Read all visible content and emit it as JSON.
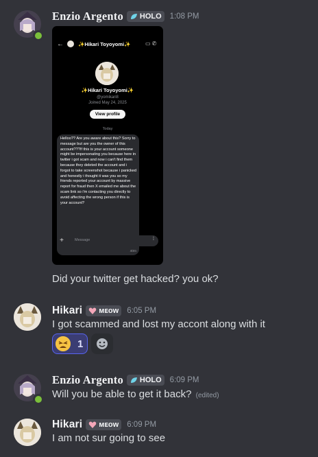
{
  "messages": [
    {
      "username": "Enzio Argento",
      "tag": "HOLO",
      "time": "1:08 PM",
      "attachment": {
        "top_name": "✨Hikari Toyoyomi✨",
        "profile_name": "✨Hikari Toyoyomi✨",
        "handle": "@yomikari8",
        "joined": "Joined May 24, 2025",
        "view_profile": "View profile",
        "today": "Today",
        "dm_text": "Helloo?? Are you aware about this? Sorry to message but are you the owner of this account???If this is your account someone might be impersonating you because here in twitter i got scam and now i can't find them because they deleted the account and i forgot to take screenshot because i panicked and honestly i thought it was you so my friends reported your account by massive report for fraud then X emailed me about the scam link so i'm contacting you directly to avoid affecting the wrong person if this is your account?",
        "dm_time": "40m",
        "compose_placeholder": "Message"
      },
      "text": "Did your twitter get hacked? you ok?"
    },
    {
      "username": "Hikari",
      "tag": "ᴍᴇᴏᴡ",
      "time": "6:05 PM",
      "text": "I got scammed and lost my accont along with it",
      "reaction": {
        "emoji": "tired-face-emoji",
        "count": "1"
      }
    },
    {
      "username": "Enzio Argento",
      "tag": "HOLO",
      "time": "6:09 PM",
      "text": "Will you be able to get it back?",
      "edited": "(edited)"
    },
    {
      "username": "Hikari",
      "tag": "ᴍᴇᴏᴡ",
      "time": "6:09 PM",
      "text": "I am not sur going to see"
    }
  ],
  "colors": {
    "background": "#323339",
    "reaction_border": "#5865f2",
    "status_online": "#7bbf3b"
  }
}
